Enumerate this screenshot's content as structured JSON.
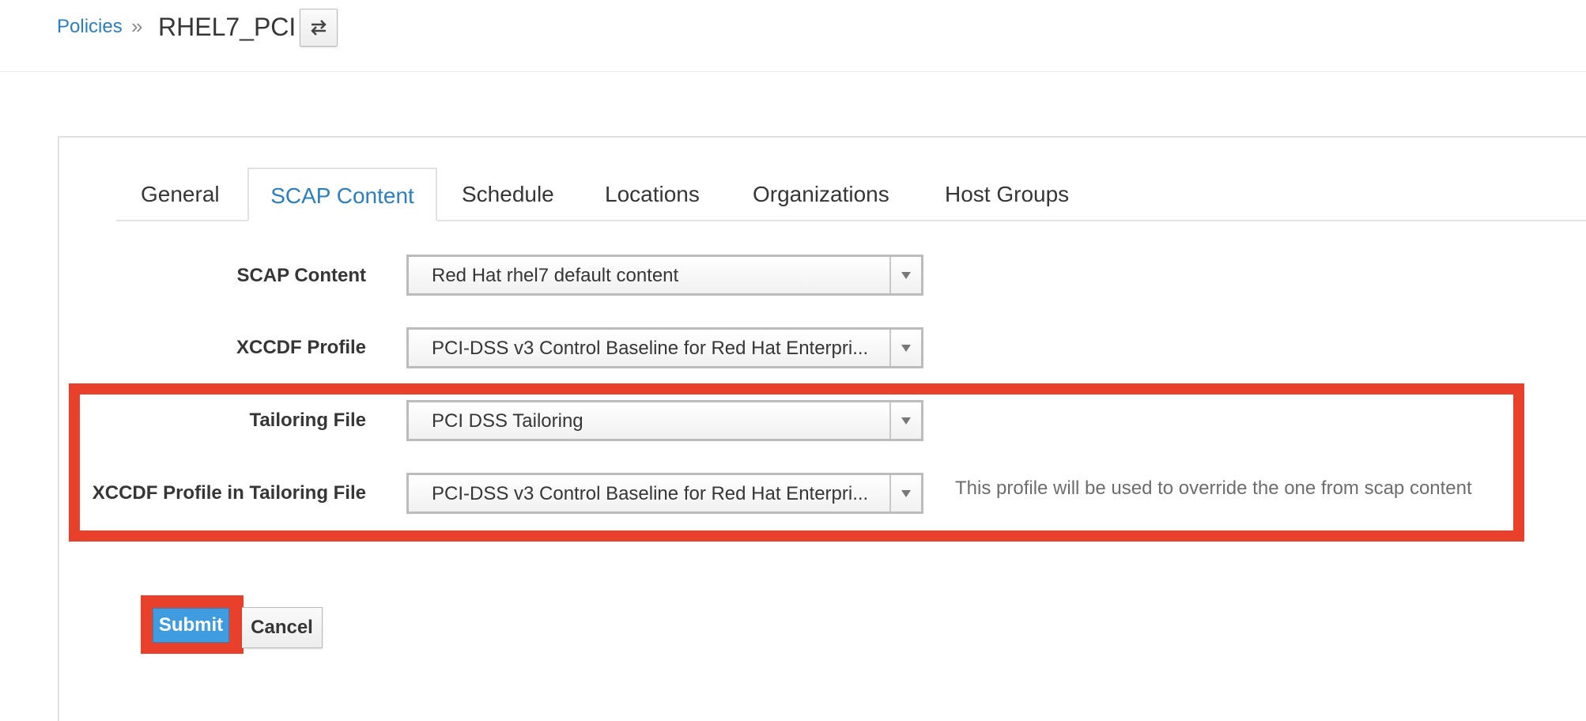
{
  "breadcrumb": {
    "parent": "Policies",
    "separator": "»",
    "current": "RHEL7_PCI",
    "switcher_icon": "switch-arrows-icon"
  },
  "tabs": [
    {
      "label": "General",
      "active": false
    },
    {
      "label": "SCAP Content",
      "active": true
    },
    {
      "label": "Schedule",
      "active": false
    },
    {
      "label": "Locations",
      "active": false
    },
    {
      "label": "Organizations",
      "active": false
    },
    {
      "label": "Host Groups",
      "active": false
    }
  ],
  "form": {
    "scap_content": {
      "label": "SCAP Content",
      "value": "Red Hat rhel7 default content"
    },
    "xccdf_profile": {
      "label": "XCCDF Profile",
      "value": "PCI-DSS v3 Control Baseline for Red Hat Enterpri..."
    },
    "tailoring_file": {
      "label": "Tailoring File",
      "value": "PCI DSS Tailoring"
    },
    "tailoring_profile": {
      "label": "XCCDF Profile in Tailoring File",
      "value": "PCI-DSS v3 Control Baseline for Red Hat Enterpri...",
      "help": "This profile will be used to override the one from scap content"
    }
  },
  "actions": {
    "submit": "Submit",
    "cancel": "Cancel"
  },
  "colors": {
    "link": "#2a7fc1",
    "highlight": "#e8402a",
    "primary": "#3f9ce0"
  }
}
